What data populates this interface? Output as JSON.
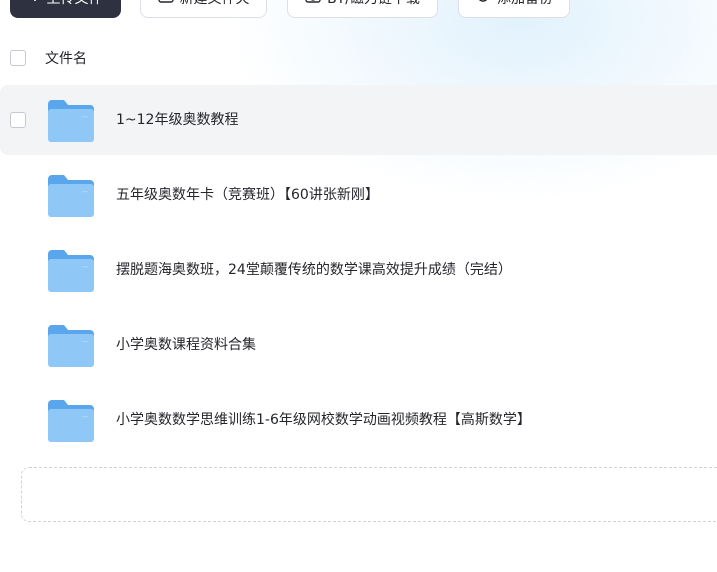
{
  "toolbar": {
    "upload_label": "上传文件",
    "new_folder_label": "新建文件夹",
    "bt_label": "BT/磁力链下载",
    "backup_label": "添加备份"
  },
  "header": {
    "column_name": "文件名"
  },
  "files": [
    {
      "name": "1~12年级奥数教程"
    },
    {
      "name": "五年级奥数年卡（竞赛班）【60讲张新刚】"
    },
    {
      "name": "摆脱题海奥数班，24堂颠覆传统的数学课高效提升成绩（完结）"
    },
    {
      "name": "小学奥数课程资料合集"
    },
    {
      "name": "小学奥数数学思维训练1-6年级网校数学动画视频教程【高斯数学】"
    }
  ],
  "colors": {
    "folder_back": "#5aa6ec",
    "folder_front": "#8fc8f7",
    "hover_row": "#f3f4f6",
    "primary_button": "#2e3140"
  }
}
